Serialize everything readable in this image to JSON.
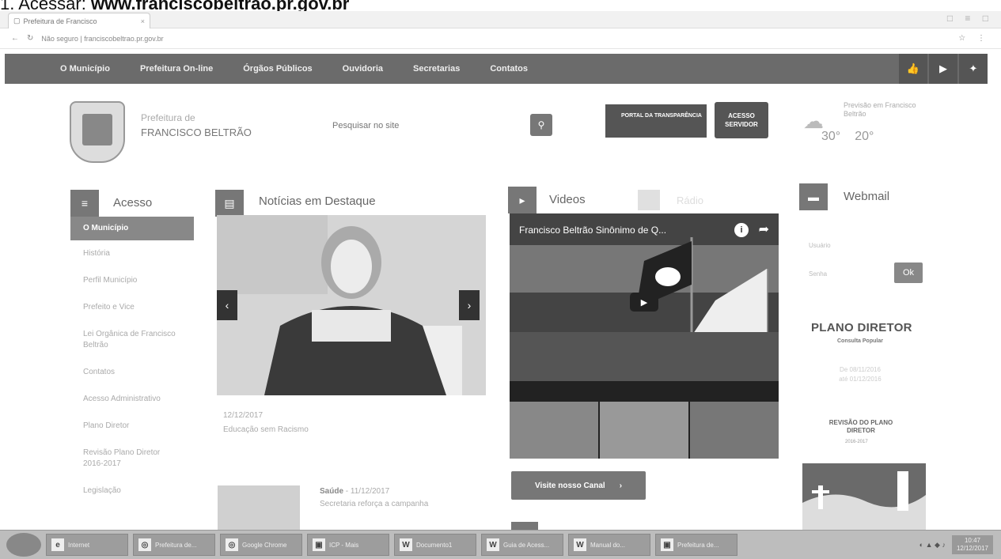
{
  "caption": {
    "prefix": "1. Acessar: ",
    "url": "www.franciscobeltrao.pr.gov.br"
  },
  "browser": {
    "tab_title": "Prefeitura de Francisco",
    "tab_close": "×",
    "window_controls": "□ ≡ □",
    "address": "Não seguro | franciscobeltrao.pr.gov.br"
  },
  "nav": {
    "items": [
      "O Município",
      "Prefeitura On-line",
      "Órgãos Públicos",
      "Ouvidoria",
      "Secretarias",
      "Contatos"
    ]
  },
  "social": {
    "icons": [
      "thumbs-up-icon",
      "youtube-icon",
      "twitter-icon"
    ]
  },
  "header": {
    "pref_small": "Prefeitura de",
    "pref_big": "FRANCISCO BELTRÃO",
    "search_placeholder": "Pesquisar no site",
    "transparencia_label": "PORTAL DA TRANSPARÊNCIA",
    "servidor_label_1": "ACESSO",
    "servidor_label_2": "SERVIDOR",
    "weather_location": "Previsão em Francisco Beltrão",
    "temp_max": "30°",
    "temp_min": "20°"
  },
  "acesso": {
    "title": "Acesso",
    "items": [
      "O Município",
      "História",
      "Perfil Município",
      "Prefeito e Vice",
      "Lei Orgânica de Francisco Beltrão",
      "Contatos",
      "Acesso Administrativo",
      "Plano Diretor",
      "Revisão Plano Diretor 2016-2017",
      "Legislação"
    ]
  },
  "noticias": {
    "title": "Notícias em Destaque",
    "date": "12/12/2017",
    "caption": "Educação sem Racismo",
    "item2_category": "Saúde",
    "item2_date": "- 11/12/2017",
    "item2_text": "Secretaria reforça a campanha"
  },
  "videos": {
    "title": "Videos",
    "tab2": "Rádio",
    "video_title": "Francisco Beltrão Sinônimo de Q...",
    "canal_button": "Visite nosso Canal",
    "canal_arrow": "›"
  },
  "webmail": {
    "title": "Webmail",
    "user_label": "Usuário",
    "pass_label": "Senha",
    "ok_button": "Ok"
  },
  "plano": {
    "title": "PLANO DIRETOR",
    "subtitle": "Consulta Popular",
    "line1": "De 08/11/2016",
    "line2": "até 01/12/2016",
    "revisao_title": "REVISÃO DO PLANO DIRETOR",
    "revisao_sub": "2016-2017"
  },
  "taskbar": {
    "items": [
      {
        "icon": "ie-icon",
        "label": "Internet"
      },
      {
        "icon": "chrome-icon",
        "label": "Prefeitura de..."
      },
      {
        "icon": "chrome-icon",
        "label": "Google Chrome"
      },
      {
        "icon": "app-icon",
        "label": "ICP - Mais"
      },
      {
        "icon": "W",
        "label": "Documento1"
      },
      {
        "icon": "W",
        "label": "Guia de Acess..."
      },
      {
        "icon": "W",
        "label": "Manual do..."
      },
      {
        "icon": "app-icon",
        "label": "Prefeitura de..."
      }
    ],
    "clock_time": "10:47",
    "clock_date": "12/12/2017"
  }
}
